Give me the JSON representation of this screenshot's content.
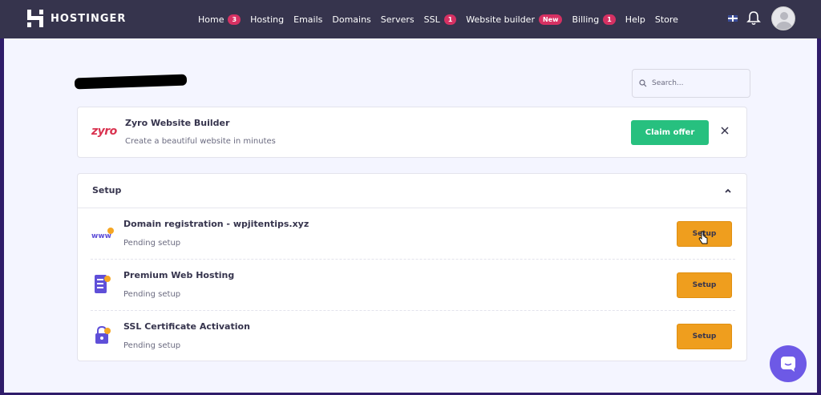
{
  "brand": {
    "name": "HOSTINGER"
  },
  "nav": [
    {
      "label": "Home",
      "badge": "3"
    },
    {
      "label": "Hosting",
      "badge": null
    },
    {
      "label": "Emails",
      "badge": null
    },
    {
      "label": "Domains",
      "badge": null
    },
    {
      "label": "Servers",
      "badge": null
    },
    {
      "label": "SSL",
      "badge": "1"
    },
    {
      "label": "Website builder",
      "badge": "New"
    },
    {
      "label": "Billing",
      "badge": "1"
    },
    {
      "label": "Help",
      "badge": null
    },
    {
      "label": "Store",
      "badge": null
    }
  ],
  "search": {
    "placeholder": "Search..."
  },
  "promo": {
    "logo": "zyro",
    "title": "Zyro Website Builder",
    "subtitle": "Create a beautiful website in minutes",
    "cta": "Claim offer"
  },
  "setup": {
    "header": "Setup",
    "rows": [
      {
        "icon": "www-icon",
        "title": "Domain registration - wpjitentips.xyz",
        "status": "Pending setup",
        "button": "Setup"
      },
      {
        "icon": "server-icon",
        "title": "Premium Web Hosting",
        "status": "Pending setup",
        "button": "Setup"
      },
      {
        "icon": "lock-icon",
        "title": "SSL Certificate Activation",
        "status": "Pending setup",
        "button": "Setup"
      }
    ]
  },
  "colors": {
    "topbar": "#36344d",
    "accent_badge": "#d63163",
    "claim_green": "#27c07f",
    "setup_orange": "#ef9e1e",
    "chat_purple": "#6d59e6"
  }
}
